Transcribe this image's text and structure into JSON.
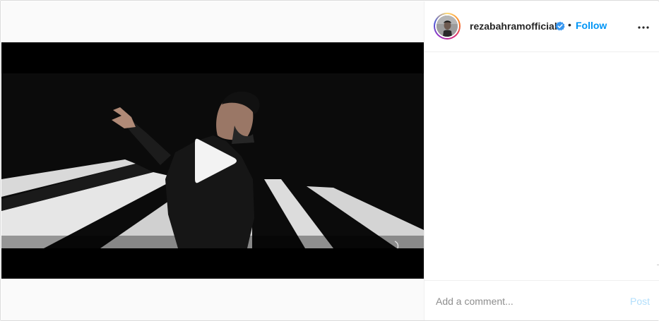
{
  "header": {
    "username": "rezabahramofficial",
    "verified": true,
    "separator": "•",
    "follow_label": "Follow",
    "more_icon": "more-horizontal-icon"
  },
  "media": {
    "type": "video",
    "play_icon": "play-icon"
  },
  "comment_bar": {
    "placeholder": "Add a comment...",
    "value": "",
    "post_label": "Post"
  },
  "colors": {
    "accent": "#0095f6",
    "post_disabled": "#b2dffc",
    "verified_badge": "#3897f0",
    "border": "#dbdbdb"
  }
}
